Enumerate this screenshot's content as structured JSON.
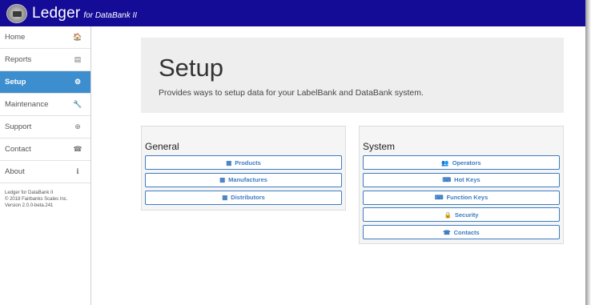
{
  "header": {
    "brand": "Ledger",
    "brand_suffix": "for DataBank II"
  },
  "sidebar": {
    "items": [
      {
        "label": "Home",
        "icon": "home-icon",
        "glyph": "🏠"
      },
      {
        "label": "Reports",
        "icon": "list-icon",
        "glyph": "▤"
      },
      {
        "label": "Setup",
        "icon": "gear-icon",
        "glyph": "⚙"
      },
      {
        "label": "Maintenance",
        "icon": "wrench-icon",
        "glyph": "🔧"
      },
      {
        "label": "Support",
        "icon": "lifebuoy-icon",
        "glyph": "⊕"
      },
      {
        "label": "Contact",
        "icon": "phone-icon",
        "glyph": "☎"
      },
      {
        "label": "About",
        "icon": "info-icon",
        "glyph": "ℹ"
      }
    ],
    "footer": {
      "line1": "Ledger for DataBank II",
      "line2": "© 2018 Fairbanks Scales Inc.",
      "line3": "Version 2.0.0-beta.241"
    }
  },
  "hero": {
    "title": "Setup",
    "description": "Provides ways to setup data for your LabelBank and DataBank system."
  },
  "general": {
    "title": "General",
    "buttons": [
      {
        "label": "Products",
        "icon": "table-icon",
        "glyph": "▦"
      },
      {
        "label": "Manufactures",
        "icon": "table-icon",
        "glyph": "▦"
      },
      {
        "label": "Distributors",
        "icon": "table-icon",
        "glyph": "▦"
      }
    ]
  },
  "system": {
    "title": "System",
    "buttons": [
      {
        "label": "Operators",
        "icon": "users-icon",
        "glyph": "👥"
      },
      {
        "label": "Hot Keys",
        "icon": "keyboard-icon",
        "glyph": "⌨"
      },
      {
        "label": "Function Keys",
        "icon": "keyboard-icon",
        "glyph": "⌨"
      },
      {
        "label": "Security",
        "icon": "lock-icon",
        "glyph": "🔒"
      },
      {
        "label": "Contacts",
        "icon": "phone-icon",
        "glyph": "☎"
      }
    ]
  },
  "colors": {
    "topbar": "#140b96",
    "active_nav": "#3d8ecf",
    "button_accent": "#3d7cc2"
  }
}
